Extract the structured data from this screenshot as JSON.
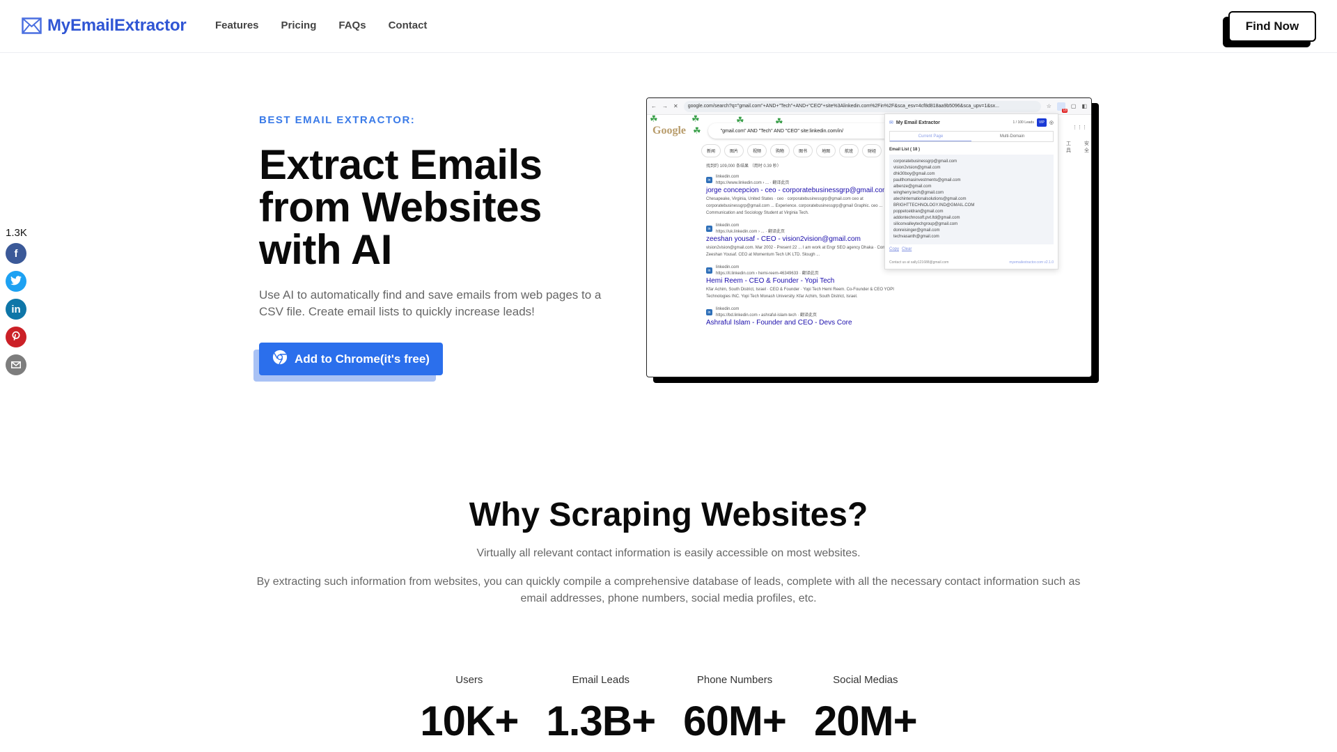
{
  "header": {
    "logo_text": "MyEmailExtractor",
    "nav": [
      "Features",
      "Pricing",
      "FAQs",
      "Contact"
    ],
    "cta_label": "Find Now",
    "brand_color": "#2f55d4"
  },
  "social": {
    "share_count": "1.3K",
    "buttons": [
      {
        "name": "facebook",
        "glyph": "f",
        "color": "#3b5998"
      },
      {
        "name": "twitter",
        "glyph": "🐦",
        "color": "#1da1f2"
      },
      {
        "name": "linkedin",
        "glyph": "in",
        "color": "#0e76a8"
      },
      {
        "name": "pinterest",
        "glyph": "P",
        "color": "#cb2027"
      },
      {
        "name": "email",
        "glyph": "✉",
        "color": "#7d7d7d"
      }
    ]
  },
  "hero": {
    "eyebrow": "BEST EMAIL EXTRACTOR:",
    "title": "Extract Emails from Websites with AI",
    "description": "Use AI to automatically find and save emails from web pages to a CSV file. Create email lists to quickly increase leads!",
    "cta_label": "Add to Chrome(it's free)",
    "accent_color": "#2b6fec"
  },
  "screenshot": {
    "url": "google.com/search?q=\"gmail.com\"+AND+\"Tech\"+AND+\"CEO\"+site%3Alinkedin.com%2Fin%2F&sca_esv=4cf8d818aa9b5096&sca_upv=1&sx...",
    "ext_badge": "18",
    "google_logo": "Google",
    "query": "\"gmail.com\" AND \"Tech\" AND \"CEO\" site:linkedin.com/in/",
    "chips": [
      "新闻",
      "图片",
      "视频",
      "购物",
      "图书",
      "地图",
      "航班",
      "财经"
    ],
    "right_tools": [
      "工具",
      "安全"
    ],
    "result_count": "找到约 109,000 条结果 （用时 0.39 秒）",
    "results": [
      {
        "site": "linkedin.com",
        "url": "https://www.linkedin.com › ... · 翻译此页",
        "title": "jorge concepcion - ceo - corporatebusinessgrp@gmail.com",
        "snippet": "Chesapeake, Virginia, United States · ceo · corporatebusinessgrp@gmail.com ceo at corporatebusinessgrp@gmail.com ... Experience. corporatebusinessgrp@gmail Graphic. ceo ... Communication and Sociology Student at Virginia Tech."
      },
      {
        "site": "linkedin.com",
        "url": "https://uk.linkedin.com › ... · 翻译此页",
        "title": "zeeshan yousaf - CEO - vision2vision@gmail.com",
        "snippet": "vision2vision@gmail.com. Mar 2002 - Present 22 ... I am work at Engr SEO agency Dhaka · Connect ... Zeeshan Yousaf. CEO at Momentum Tech UK LTD. Slough ..."
      },
      {
        "site": "linkedin.com",
        "url": "https://il.linkedin.com › hemi-reem-46349633 · 翻译此页",
        "title": "Hemi Reem - CEO & Founder - Yopi Tech",
        "snippet": "Kfar Achim, South District, Israel · CEO & Founder · Yopi Tech Hemi Reem. Co-Founder & CEO YOPI Technologies INC. Yopi Tech Monash University. Kfar Achim, South District, Israel."
      },
      {
        "site": "linkedin.com",
        "url": "https://bd.linkedin.com › ashraful-islam-tech · 翻译此页",
        "title": "Ashraful Islam - Founder and CEO - Devs Core",
        "snippet": ""
      }
    ],
    "popup": {
      "title": "My Email Extractor",
      "leads": "1 / 100 Leads",
      "vip": "VIP",
      "tabs": [
        "Current Page",
        "Multi-Domain"
      ],
      "list_title": "Email List ( 18 )",
      "emails": [
        "corporatebusinessgrp@gmail.com",
        "vision2vision@gmail.com",
        "dhk30boy@gmail.com",
        "paulthomasinvestments@gmail.com",
        "albenze@gmail.com",
        "wingherry.tech@gmail.com",
        "atechinternationalsolutions@gmail.com",
        "BRIGHTTECHNOLOGY.IND@GMAIL.COM",
        "poppetceldran@gmail.com",
        "addontechnosoft.pvt.ltd@gmail.com",
        "siliconvalleytechgroup@gmail.com",
        "donreisinger@gmail.com",
        "techvasanth@gmail.com"
      ],
      "copy_label": "Copy",
      "clear_label": "Clear",
      "contact": "Contact us at sally121688@gmail.com",
      "version": "myemailextractor.com v2.1.0"
    }
  },
  "why": {
    "title": "Why Scraping Websites?",
    "subtitle": "Virtually all relevant contact information is easily accessible on most websites.",
    "description": "By extracting such information from websites, you can quickly compile a comprehensive database of leads, complete with all the necessary contact information such as email addresses, phone numbers, social media profiles, etc."
  },
  "stats": [
    {
      "label": "Users",
      "value": "10K+"
    },
    {
      "label": "Email Leads",
      "value": "1.3B+"
    },
    {
      "label": "Phone Numbers",
      "value": "60M+"
    },
    {
      "label": "Social Medias",
      "value": "20M+"
    }
  ]
}
